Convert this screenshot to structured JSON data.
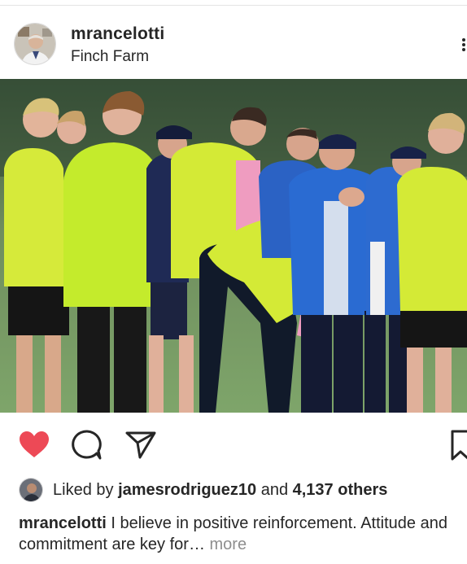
{
  "post": {
    "username": "mrancelotti",
    "location": "Finch Farm",
    "photo_description_icon": "team-training-photo"
  },
  "actions": {
    "like_icon": "heart-filled-icon",
    "comment_icon": "comment-icon",
    "share_icon": "send-icon",
    "save_icon": "bookmark-icon",
    "liked": true
  },
  "likes": {
    "prefix": "Liked by ",
    "user": "jamesrodriguez10",
    "middle": " and ",
    "count": "4,137 others"
  },
  "caption": {
    "username": "mrancelotti",
    "text": " I believe in positive reinforcement. Attitude and commitment are key for…",
    "more": "more"
  },
  "colors": {
    "heart": "#ed4956",
    "text": "#262626",
    "muted": "#8e8e8e"
  }
}
